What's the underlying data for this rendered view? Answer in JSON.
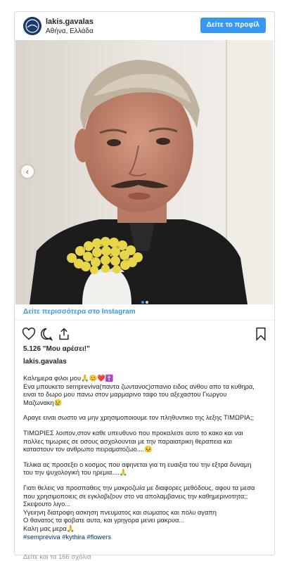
{
  "header": {
    "username": "lakis.gavalas",
    "location": "Αθήνα, Ελλάδα",
    "profile_button": "Δείτε το προφίλ"
  },
  "link_more": "Δείτε περισσότερα στο Instagram",
  "likes": "5.126 \"Μου αρέσει!\"",
  "poster": "lakis.gavalas",
  "caption": {
    "p1": [
      "Καλημερα φιλοι μου🙏😊❤️✝️",
      "Ενα μπουκετο semprevivα(παντα ζωντανος)σπανιο ειδος ανθου απο τα κυθηρα,",
      "ειναι το δωρο μου πανω στον μαρμαρινο ταφο του αξεχαστου Γιωργου",
      "Μαζωνακη😢"
    ],
    "p2": [
      "Αραγε ειναι σωστο να μην χρησιμοποιουμε τον πληθυντικο της λεξης ΤΙΜΩΡΙΑ;;"
    ],
    "p3": [
      "ΤΙΜΩΡΙΕΣ λοιπον,στον καθε υπευθυνο που προκαλεσε αυτο το κακο και ναι",
      "πολλες τιμωριες σε οσους ασχολουνται με την παραιατρικη θεραπεια και",
      "καταστουν τον ανθρωπο πειραματοζωο....😣"
    ],
    "p4": [
      "Τελικα ας προσεξει ο κοσμος που αφηνεται για τη ευαιξια του την εξτρα δυναμη",
      "του την ψυχολογική του ηρεμια....🙏"
    ],
    "p5": [
      "Γιατι θελεις να προσπαθεις την μακροζωία με διαφορες μεθόδους, αφου τα μεσα",
      "που χρησιμοποιεις σε εγκλοβιζουν στο να απολαμβανεις την καθημερινοτητα;;",
      "Σκεψουτο λιγο...",
      "Υγειηνη διατροφη ασκηση πνευματος και σωματος και πολυ αγαπη",
      "Ο θανατος τα φοβατε αυτα, και γρηγορα μενει μακρυα...",
      "Καλη μας μερα🙏"
    ],
    "tags": "#sempreviva #kythira #flowers"
  },
  "comments_link": "Δείτε και τα 166 σχόλια",
  "colors": {
    "accent": "#3897f0",
    "text": "#262626",
    "muted": "#999999",
    "border": "#dbdbdb"
  },
  "icons": [
    "heart-icon",
    "comment-icon",
    "share-icon",
    "bookmark-icon",
    "chevron-left-icon"
  ]
}
